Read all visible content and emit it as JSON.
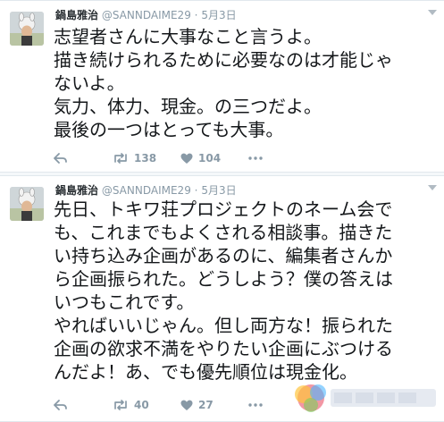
{
  "tweets": [
    {
      "user_name": "鍋島雅治",
      "handle": "@SANNDAIME29",
      "separator": "·",
      "date": "5月3日",
      "lines": [
        "志望者さんに大事なこと言うよ。",
        "描き続けられるために必要なのは才能じゃ",
        "ないよ。",
        "気力、体力、現金。の三つだよ。",
        "最後の一つはとっても大事。"
      ],
      "retweets": "138",
      "likes": "104",
      "icons": [
        "reply-icon",
        "retweet-icon",
        "heart-icon",
        "more-icon"
      ]
    },
    {
      "user_name": "鍋島雅治",
      "handle": "@SANNDAIME29",
      "separator": "·",
      "date": "5月3日",
      "lines": [
        "先日、トキワ荘プロジェクトのネーム会で",
        "も、これまでもよくされる相談事。描きた",
        "い持ち込み企画があるのに、編集者さんか",
        "ら企画振られた。どうしよう？僕の答えは",
        "いつもこれです。",
        "やればいいじゃん。但し両方な！振られた",
        "企画の欲求不満をやりたい企画にぶつける",
        "んだよ！あ、でも優先順位は現金化。"
      ],
      "retweets": "40",
      "likes": "27",
      "icons": [
        "reply-icon",
        "retweet-icon",
        "heart-icon",
        "more-icon"
      ]
    }
  ],
  "colors": {
    "text": "#14171a",
    "meta": "#8899a6",
    "border": "#e1e8ed",
    "background": "#f5f8fa"
  }
}
